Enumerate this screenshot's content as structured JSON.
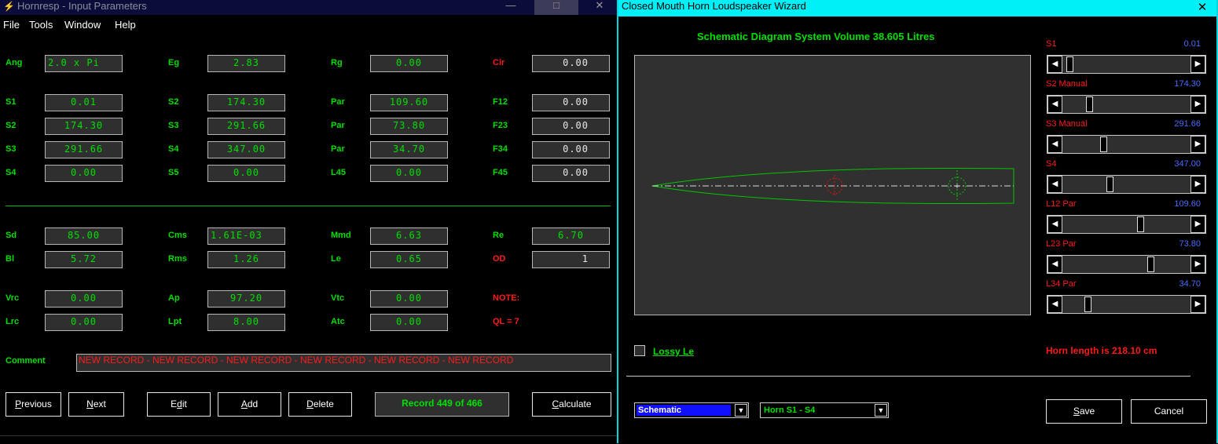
{
  "left_window": {
    "title": "Hornresp - Input Parameters",
    "menu": [
      "File",
      "Tools",
      "Window",
      "Help"
    ],
    "window_controls": {
      "minimize": "—",
      "maximize": "□",
      "close": "✕"
    },
    "rows": {
      "ang": {
        "label": "Ang",
        "value": "2.0 x Pi"
      },
      "eg": {
        "label": "Eg",
        "value": "2.83"
      },
      "rg": {
        "label": "Rg",
        "value": "0.00"
      },
      "cir": {
        "label": "Cir",
        "value": "0.00"
      },
      "s1a": {
        "label": "S1",
        "value": "0.01"
      },
      "s2a": {
        "label": "S2",
        "value": "174.30"
      },
      "par1": {
        "label": "Par",
        "value": "109.60"
      },
      "f12": {
        "label": "F12",
        "value": "0.00"
      },
      "s2b": {
        "label": "S2",
        "value": "174.30"
      },
      "s3a": {
        "label": "S3",
        "value": "291.66"
      },
      "par2": {
        "label": "Par",
        "value": "73.80"
      },
      "f23": {
        "label": "F23",
        "value": "0.00"
      },
      "s3b": {
        "label": "S3",
        "value": "291.66"
      },
      "s4a": {
        "label": "S4",
        "value": "347.00"
      },
      "par3": {
        "label": "Par",
        "value": "34.70"
      },
      "f34": {
        "label": "F34",
        "value": "0.00"
      },
      "s4b": {
        "label": "S4",
        "value": "0.00"
      },
      "s5": {
        "label": "S5",
        "value": "0.00"
      },
      "l45": {
        "label": "L45",
        "value": "0.00"
      },
      "f45": {
        "label": "F45",
        "value": "0.00"
      },
      "sd": {
        "label": "Sd",
        "value": "85.00"
      },
      "cms": {
        "label": "Cms",
        "value": "1.61E-03"
      },
      "mmd": {
        "label": "Mmd",
        "value": "6.63"
      },
      "re": {
        "label": "Re",
        "value": "6.70"
      },
      "bl": {
        "label": "Bl",
        "value": "5.72"
      },
      "rms": {
        "label": "Rms",
        "value": "1.26"
      },
      "le": {
        "label": "Le",
        "value": "0.65"
      },
      "od": {
        "label": "OD",
        "value": "1"
      },
      "vrc": {
        "label": "Vrc",
        "value": "0.00"
      },
      "ap": {
        "label": "Ap",
        "value": "97.20"
      },
      "vtc": {
        "label": "Vtc",
        "value": "0.00"
      },
      "note": {
        "label": "NOTE:"
      },
      "lrc": {
        "label": "Lrc",
        "value": "0.00"
      },
      "lpt": {
        "label": "Lpt",
        "value": "8.00"
      },
      "atc": {
        "label": "Atc",
        "value": "0.00"
      },
      "ql": {
        "label": "QL = 7"
      }
    },
    "comment_label": "Comment",
    "comment_value": "NEW RECORD - NEW RECORD - NEW RECORD - NEW RECORD - NEW RECORD - NEW RECORD",
    "buttons": {
      "previous": {
        "u": "P",
        "rest": "revious"
      },
      "next": {
        "u": "N",
        "rest": "ext"
      },
      "edit": {
        "pre": "E",
        "u": "d",
        "rest": "it"
      },
      "add": {
        "u": "A",
        "rest": "dd"
      },
      "delete": {
        "u": "D",
        "rest": "elete"
      },
      "calculate": {
        "u": "C",
        "rest": "alculate"
      }
    },
    "record_text": "Record 449 of 466"
  },
  "right_window": {
    "title": "Closed Mouth Horn Loudspeaker Wizard",
    "close": "✕",
    "schematic_title": "Schematic Diagram   System Volume 38.605 Litres",
    "sliders": [
      {
        "label": "S1",
        "value": "0.01",
        "position": 0.03
      },
      {
        "label": "S2  Manual",
        "value": "174.30",
        "position": 0.19
      },
      {
        "label": "S3  Manual",
        "value": "291.66",
        "position": 0.31
      },
      {
        "label": "S4",
        "value": "347.00",
        "position": 0.36
      },
      {
        "label": "L12  Par",
        "value": "109.60",
        "position": 0.61
      },
      {
        "label": "L23  Par",
        "value": "73.80",
        "position": 0.69
      },
      {
        "label": "L34  Par",
        "value": "34.70",
        "position": 0.18
      }
    ],
    "lossy_le": "Lossy Le",
    "horn_length": "Horn length is 218.10 cm",
    "combo_schematic": "Schematic",
    "combo_horn": "Horn S1 - S4",
    "save": {
      "u": "S",
      "rest": "ave"
    },
    "cancel": "Cancel",
    "colors": {
      "accent": "#00f0f8",
      "label_green": "#00e000",
      "label_red": "#ff1a1a",
      "value_blue": "#4a6cff"
    }
  }
}
